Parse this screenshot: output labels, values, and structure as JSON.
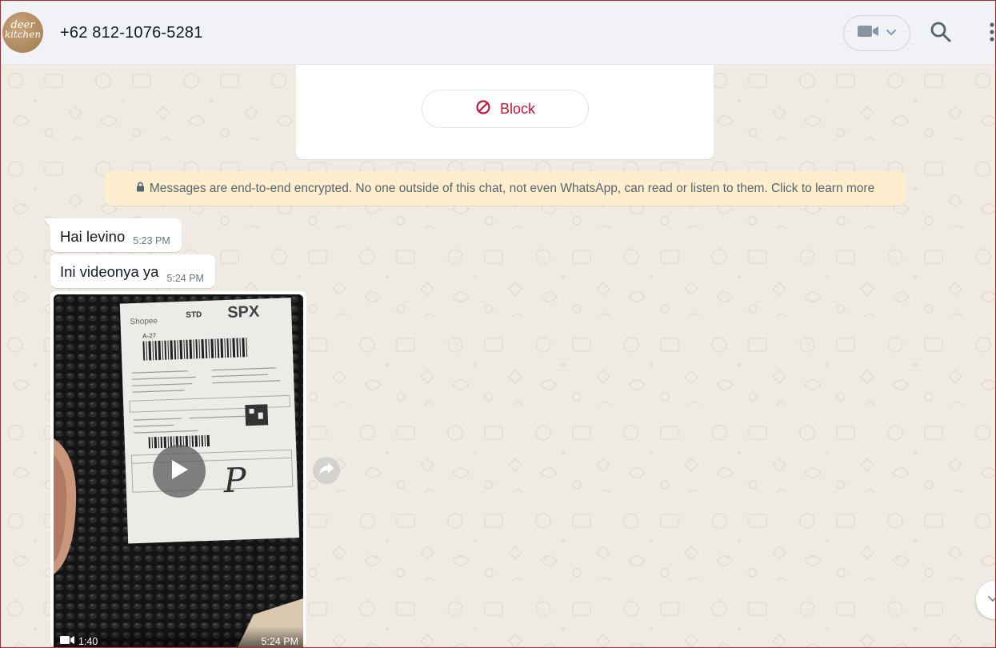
{
  "header": {
    "avatar_line1": "deer",
    "avatar_line2": "kitchen",
    "avatar_line3": "·····",
    "contact_name": "+62 812-1076-5281",
    "icons": [
      "video-call-icon",
      "chevron-down-icon",
      "search-icon",
      "menu-icon"
    ]
  },
  "contact_card": {
    "block_label": "Block",
    "block_color": "#c3173b"
  },
  "encryption_notice": {
    "text": "Messages are end-to-end encrypted. No one outside of this chat, not even WhatsApp, can read or listen to them. Click to learn more"
  },
  "messages": [
    {
      "text": "Hai levino",
      "time": "5:23 PM"
    },
    {
      "text": "Ini videonya ya",
      "time": "5:24 PM"
    }
  ],
  "video_message": {
    "duration": "1:40",
    "time": "5:24 PM",
    "label_brand": "SPX",
    "label_service": "STD",
    "label_shop": "Shopee",
    "label_code": "A-27",
    "handwritten": "P"
  },
  "colors": {
    "header_bg": "#f0f2f5",
    "chat_bg": "#efeae2",
    "banner_bg": "#ffeecd",
    "bubble_bg": "#ffffff"
  }
}
